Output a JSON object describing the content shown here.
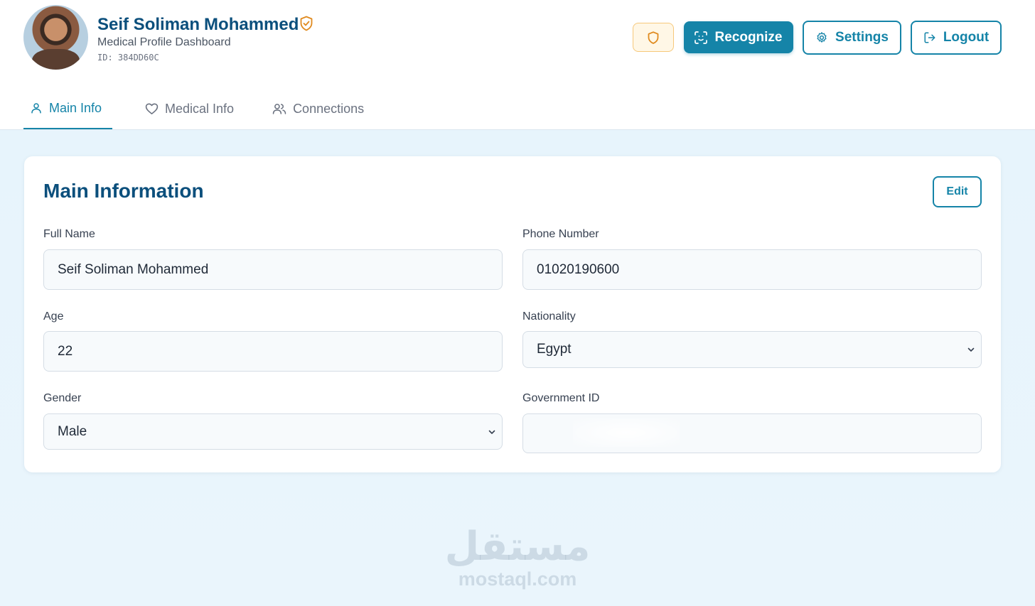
{
  "profile": {
    "first_name": "Seif Soliman",
    "last_name": "Mohammed",
    "subtitle": "Medical Profile Dashboard",
    "id_text": "ID: 384DD60C"
  },
  "header_actions": {
    "recognize_label": "Recognize",
    "settings_label": "Settings",
    "logout_label": "Logout"
  },
  "tabs": [
    {
      "label": "Main Info",
      "active": true,
      "icon": "user-icon"
    },
    {
      "label": "Medical Info",
      "active": false,
      "icon": "heart-icon"
    },
    {
      "label": "Connections",
      "active": false,
      "icon": "users-icon"
    }
  ],
  "card": {
    "title": "Main Information",
    "edit_label": "Edit"
  },
  "fields": {
    "full_name": {
      "label": "Full Name",
      "value": "Seif Soliman Mohammed"
    },
    "phone": {
      "label": "Phone Number",
      "value": "01020190600"
    },
    "age": {
      "label": "Age",
      "value": "22"
    },
    "nationality": {
      "label": "Nationality",
      "value": "Egypt"
    },
    "gender": {
      "label": "Gender",
      "value": "Male"
    },
    "government_id": {
      "label": "Government ID",
      "value": ""
    }
  },
  "watermark": {
    "arabic": "مستقل",
    "latin": "mostaql.com"
  },
  "colors": {
    "accent": "#1584a8",
    "title": "#0b4f7c",
    "warning": "#e08a1e"
  }
}
